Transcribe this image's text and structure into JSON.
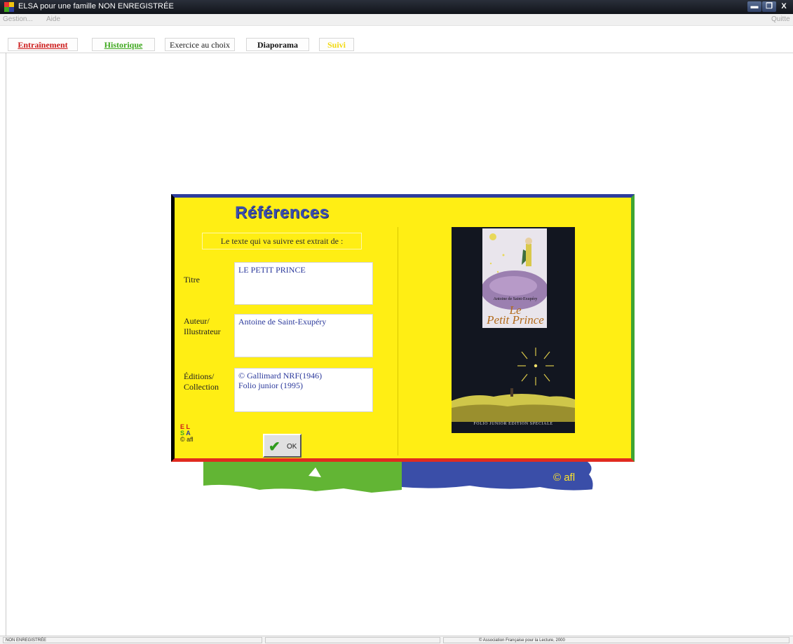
{
  "window": {
    "title": "ELSA pour une famille NON ENREGISTRÉE",
    "minimize_glyph": "▬",
    "maximize_glyph": "❐",
    "close_glyph": "X"
  },
  "menu": {
    "gestion": "Gestion...",
    "aide": "Aide",
    "quitter": "Quitte"
  },
  "toolbar": {
    "buttons": [
      {
        "label": "Entraînement",
        "color": "#cc1b1b"
      },
      {
        "label": "Historique",
        "color": "#3ea81e"
      },
      {
        "label": "Exercice au choix",
        "color": "#222222"
      },
      {
        "label": "Diaporama",
        "color": "#111111"
      },
      {
        "label": "Suivi",
        "color": "#f2d90f"
      }
    ]
  },
  "dialog": {
    "title": "Références",
    "intro": "Le texte qui va suivre est extrait de :",
    "labels": {
      "titre": "Titre",
      "auteur_l1": "Auteur/",
      "auteur_l2": "Illustrateur",
      "editions_l1": "Éditions/",
      "editions_l2": "Collection"
    },
    "fields": {
      "titre": "LE PETIT PRINCE",
      "auteur": "Antoine de Saint-Exupéry",
      "editions_l1": "© Gallimard NRF(1946)",
      "editions_l2": "Folio junior (1995)"
    },
    "logo": {
      "e": "E",
      "l": "L",
      "s": "S",
      "a": "A",
      "copyright": "© afl"
    },
    "ok": "OK",
    "cover": {
      "author": "Antoine de Saint-Exupéry",
      "title_l1": "Le",
      "title_l2": "Petit Prince",
      "footer": "FOLIO JUNIOR EDITION SPECIALE"
    }
  },
  "strip": {
    "copyright": "© afl"
  },
  "status": {
    "left": "NON ENREGISTRÉE",
    "right": "© Association Française pour la Lecture, 2000"
  },
  "colors": {
    "dialog_bg": "#ffee14",
    "border_top": "#2e3d9c",
    "border_left": "#000000",
    "border_right": "#3fa533",
    "border_bottom": "#e12b1f"
  }
}
